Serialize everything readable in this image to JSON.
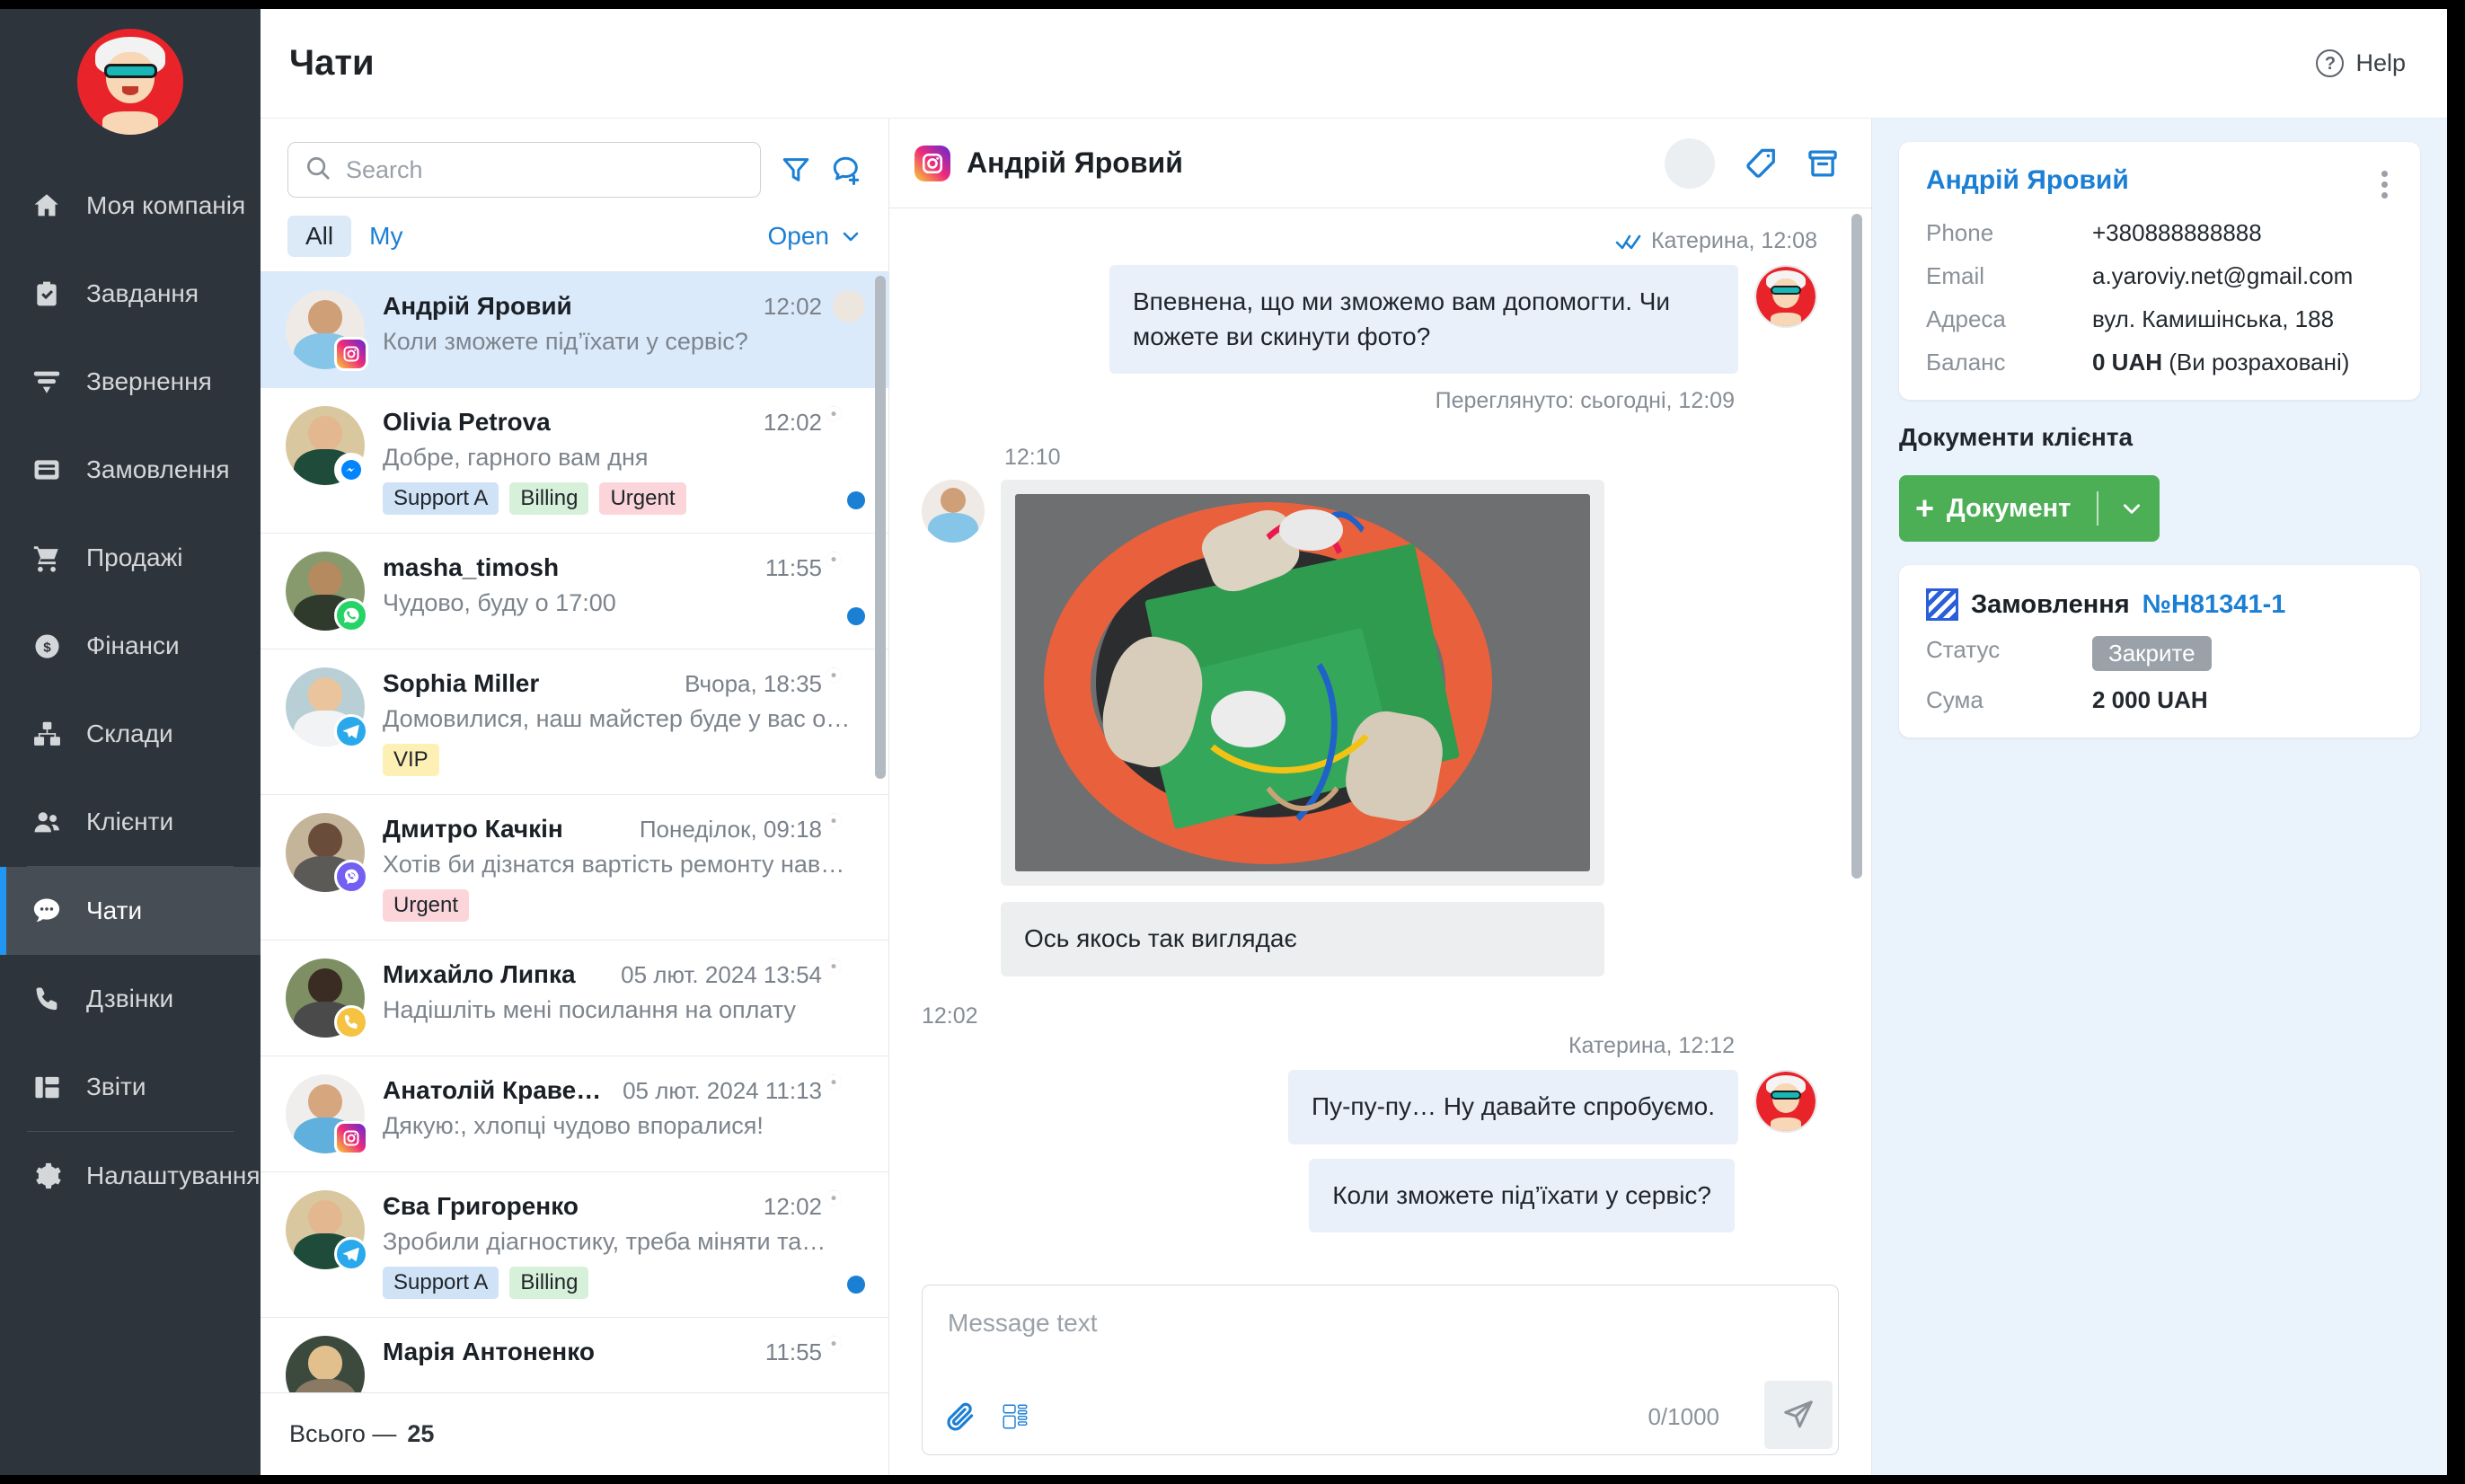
{
  "sidebar": {
    "logo_name": "company-logo",
    "items": [
      {
        "label": "Моя компанія",
        "icon": "home-icon"
      },
      {
        "label": "Завдання",
        "icon": "clipboard-check-icon"
      },
      {
        "label": "Звернення",
        "icon": "funnel-icon"
      },
      {
        "label": "Замовлення",
        "icon": "order-card-icon"
      },
      {
        "label": "Продажі",
        "icon": "shopping-cart-icon"
      },
      {
        "label": "Фінанси",
        "icon": "dollar-circle-icon"
      },
      {
        "label": "Склади",
        "icon": "warehouse-boxes-icon"
      },
      {
        "label": "Клієнти",
        "icon": "people-icon"
      },
      {
        "label": "Чати",
        "icon": "chat-bubble-icon"
      },
      {
        "label": "Дзвінки",
        "icon": "phone-icon"
      },
      {
        "label": "Звіти",
        "icon": "reports-grid-icon"
      },
      {
        "label": "Налаштування",
        "icon": "gear-icon"
      }
    ],
    "active_label": "Чати"
  },
  "topbar": {
    "title": "Чати",
    "help_label": "Help"
  },
  "chatlist": {
    "search_placeholder": "Search",
    "search_value": "",
    "tabs": [
      {
        "label": "All",
        "active": true
      },
      {
        "label": "My",
        "active": false
      }
    ],
    "sort_label": "Open",
    "footer_prefix": "Всього —",
    "footer_count": "25",
    "items": [
      {
        "name": "Андрій Яровий",
        "time": "12:02",
        "message": "Коли зможете під’їхати у сервіс?",
        "channel": "instagram",
        "tags": [],
        "selected": true,
        "unread": false,
        "operator_assigned": true
      },
      {
        "name": "Olivia Petrova",
        "time": "12:02",
        "message": "Добре, гарного вам дня",
        "channel": "messenger",
        "tags": [
          {
            "label": "Support A",
            "color": "blue"
          },
          {
            "label": "Billing",
            "color": "green"
          },
          {
            "label": "Urgent",
            "color": "red"
          }
        ],
        "selected": false,
        "unread": true,
        "operator_assigned": false
      },
      {
        "name": "masha_timosh",
        "time": "11:55",
        "message": "Чудово, буду о 17:00",
        "channel": "whatsapp",
        "tags": [],
        "selected": false,
        "unread": true,
        "operator_assigned": false
      },
      {
        "name": "Sophia Miller",
        "time": "Вчора, 18:35",
        "message": "Домовилися, наш майстер буде у вас о…",
        "channel": "telegram",
        "tags": [
          {
            "label": "VIP",
            "color": "yellow"
          }
        ],
        "selected": false,
        "unread": false,
        "operator_assigned": false
      },
      {
        "name": "Дмитро Качкін",
        "time": "Понеділок, 09:18",
        "message": "Хотів би дізнатся вартість ремонту нав…",
        "channel": "viber",
        "tags": [
          {
            "label": "Urgent",
            "color": "red"
          }
        ],
        "selected": false,
        "unread": false,
        "operator_assigned": false
      },
      {
        "name": "Михайло Липка",
        "time": "05 лют. 2024 13:54",
        "message": "Надішліть мені посилання на оплату",
        "channel": "call",
        "tags": [],
        "selected": false,
        "unread": false,
        "operator_assigned": false
      },
      {
        "name": "Анатолій Краве…",
        "time": "05 лют. 2024 11:13",
        "message": "Дякую:, хлопці чудово впоралися!",
        "channel": "instagram",
        "tags": [],
        "selected": false,
        "unread": false,
        "operator_assigned": false
      },
      {
        "name": "Єва Григоренко",
        "time": "12:02",
        "message": "Зробили діагностику, треба міняти та…",
        "channel": "telegram",
        "tags": [
          {
            "label": "Support A",
            "color": "blue"
          },
          {
            "label": "Billing",
            "color": "green"
          }
        ],
        "selected": false,
        "unread": true,
        "operator_assigned": false
      },
      {
        "name": "Марія Антоненко",
        "time": "11:55",
        "message": "",
        "channel": "telegram",
        "tags": [],
        "selected": false,
        "unread": false,
        "operator_assigned": false
      }
    ]
  },
  "conversation": {
    "title": "Андрій Яровий",
    "channel": "instagram",
    "actions": [
      {
        "name": "assigned-operator-avatar"
      },
      {
        "name": "tag-icon"
      },
      {
        "name": "archive-icon"
      }
    ],
    "messages": [
      {
        "dir": "out",
        "meta": "Катерина, 12:08",
        "read_ticks": true,
        "text": "Впевнена, що ми зможемо вам допомогти. Чи можете ви скинути фото?",
        "footer": "Переглянуто: сьогодні, 12:09"
      },
      {
        "dir": "in",
        "meta": "12:10",
        "type": "image",
        "image_alt": "Фото пошкодженої плати",
        "text": "Ось якось так виглядає"
      },
      {
        "dir": "divider",
        "meta": "12:02"
      },
      {
        "dir": "out",
        "meta": "Катерина, 12:12",
        "text": "Пу-пу-пу… Ну давайте спробуємо."
      },
      {
        "dir": "out",
        "text": "Коли зможете під’їхати у сервіс?"
      }
    ],
    "composer": {
      "placeholder": "Message text",
      "value": "",
      "counter": "0/1000",
      "attach_icon": "paperclip-icon",
      "template_icon": "template-icon",
      "send_icon": "send-icon"
    }
  },
  "rightbar": {
    "client": {
      "name": "Андрій Яровий",
      "fields": [
        {
          "key": "Phone",
          "value": "+380888888888"
        },
        {
          "key": "Email",
          "value": "a.yaroviy.net@gmail.com"
        },
        {
          "key": "Адреса",
          "value": "вул. Камишінська, 188"
        },
        {
          "key": "Баланс",
          "value_bold": "0 UAH",
          "value_rest": " (Ви розраховані)"
        }
      ]
    },
    "documents_title": "Документи клієнта",
    "add_document_label": "Документ",
    "order": {
      "label": "Замовлення",
      "number": "№H81341-1",
      "status_key": "Статус",
      "status_value": "Закрите",
      "sum_key": "Сума",
      "sum_value": "2 000 UAH"
    }
  },
  "colors": {
    "accent_blue": "#1b7fd4",
    "sidebar_bg": "#2e343b",
    "active_nav": "#464d55",
    "green_button": "#4caf56",
    "right_panel_bg": "#eaf2fb",
    "selected_chat": "#dbeafb"
  }
}
